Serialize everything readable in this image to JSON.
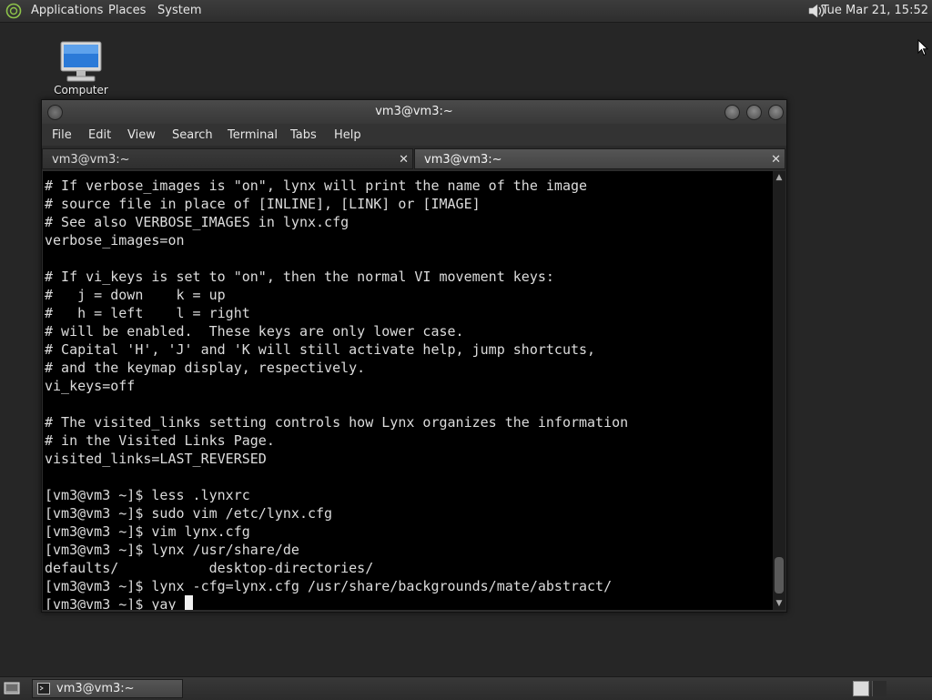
{
  "top_panel": {
    "menus": [
      "Applications",
      "Places",
      "System"
    ],
    "clock": "Tue Mar 21, 15:52",
    "volume_icon": "speaker-icon",
    "logo_icon": "mate-logo-icon"
  },
  "desktop": {
    "icons": [
      {
        "label": "Computer",
        "icon": "computer-icon"
      }
    ]
  },
  "window": {
    "title": "vm3@vm3:~",
    "menu": [
      "File",
      "Edit",
      "View",
      "Search",
      "Terminal",
      "Tabs",
      "Help"
    ],
    "tabs": [
      {
        "label": "vm3@vm3:~",
        "active": false
      },
      {
        "label": "vm3@vm3:~",
        "active": true
      }
    ],
    "close_glyph": "✕",
    "terminal_lines": [
      "# If verbose_images is \"on\", lynx will print the name of the image",
      "# source file in place of [INLINE], [LINK] or [IMAGE]",
      "# See also VERBOSE_IMAGES in lynx.cfg",
      "verbose_images=on",
      "",
      "# If vi_keys is set to \"on\", then the normal VI movement keys:",
      "#   j = down    k = up",
      "#   h = left    l = right",
      "# will be enabled.  These keys are only lower case.",
      "# Capital 'H', 'J' and 'K will still activate help, jump shortcuts,",
      "# and the keymap display, respectively.",
      "vi_keys=off",
      "",
      "# The visited_links setting controls how Lynx organizes the information",
      "# in the Visited Links Page.",
      "visited_links=LAST_REVERSED",
      "",
      "[vm3@vm3 ~]$ less .lynxrc",
      "[vm3@vm3 ~]$ sudo vim /etc/lynx.cfg",
      "[vm3@vm3 ~]$ vim lynx.cfg",
      "[vm3@vm3 ~]$ lynx /usr/share/de",
      "defaults/           desktop-directories/",
      "[vm3@vm3 ~]$ lynx -cfg=lynx.cfg /usr/share/backgrounds/mate/abstract/",
      "[vm3@vm3 ~]$ yay "
    ]
  },
  "bottom_panel": {
    "task_label": "vm3@vm3:~",
    "task_icon": "terminal-icon",
    "show_desktop_icon": "show-desktop-icon"
  },
  "colors": {
    "desktop_bg": "#262626",
    "terminal_bg": "#000000",
    "terminal_fg": "#dcdcdc"
  }
}
